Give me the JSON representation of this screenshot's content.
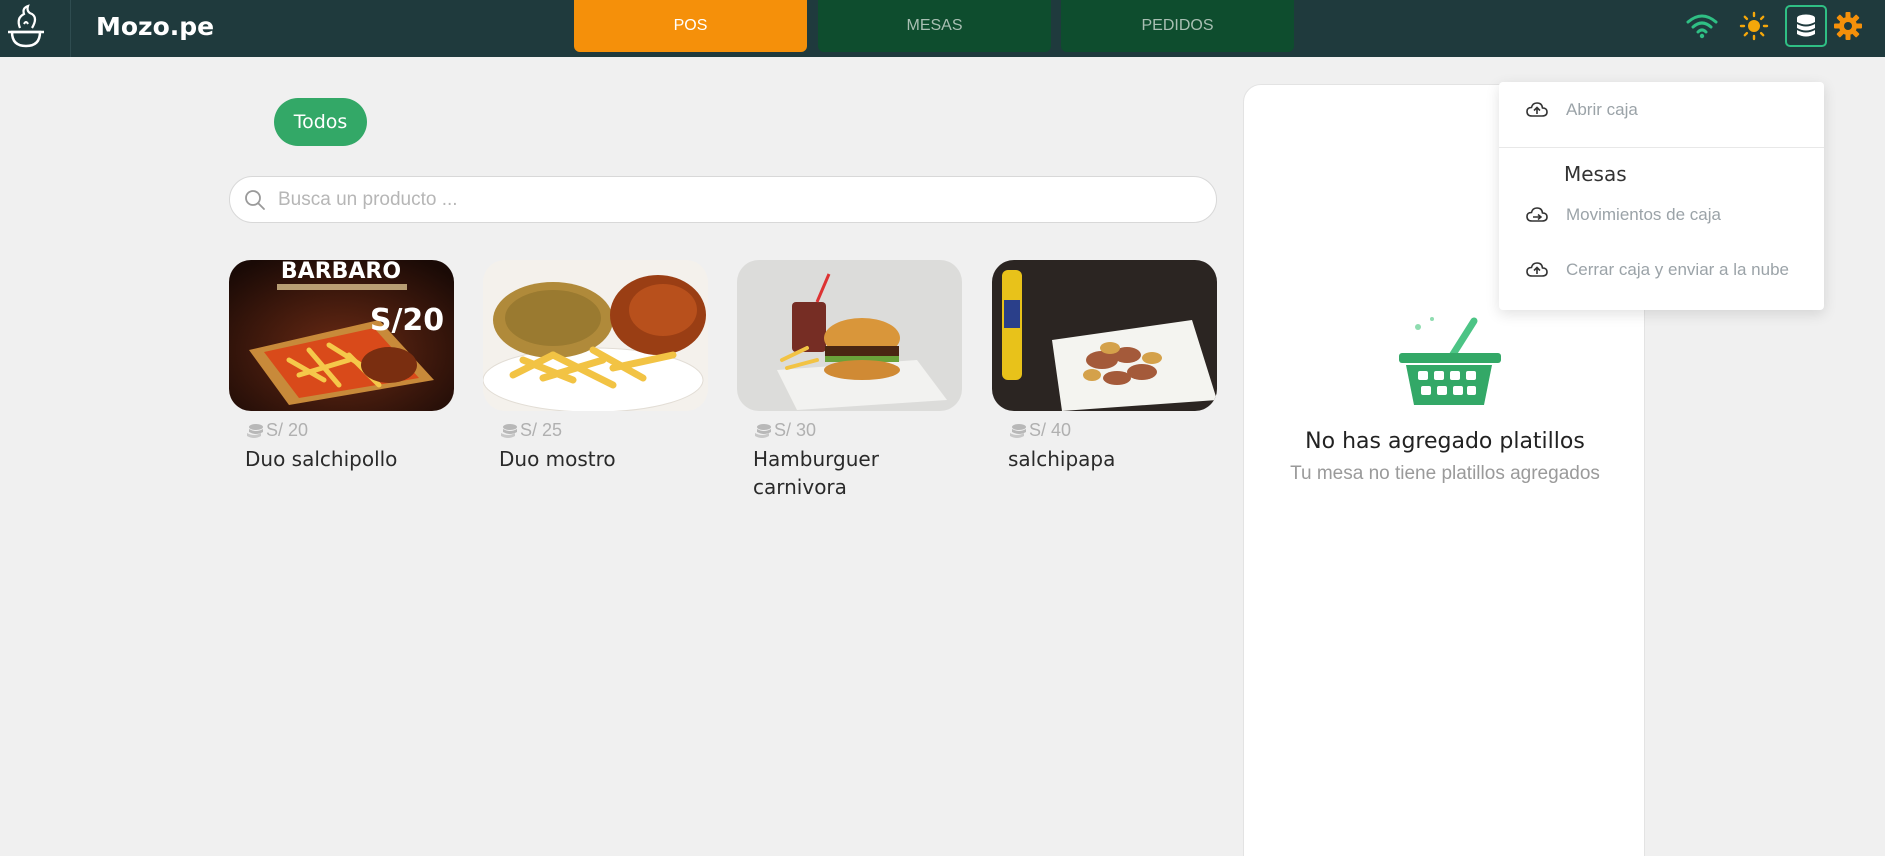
{
  "brand": {
    "name": "Mozo.pe",
    "logo_icon": "chef-hat-icon"
  },
  "tabs": [
    {
      "label": "POS",
      "active": true
    },
    {
      "label": "MESAS",
      "active": false
    },
    {
      "label": "PEDIDOS",
      "active": false
    }
  ],
  "topbar_icons": {
    "wifi": "wifi-icon",
    "theme": "sun-icon",
    "cash": "coins-icon",
    "settings": "gear-icon"
  },
  "filters": {
    "active_label": "Todos"
  },
  "search": {
    "placeholder": "Busca un producto ...",
    "value": ""
  },
  "products": [
    {
      "price": "S/ 20",
      "name": "Duo salchipollo",
      "image_text": "BARBARO",
      "image_badge": "S/20"
    },
    {
      "price": "S/ 25",
      "name": "Duo mostro"
    },
    {
      "price": "S/ 30",
      "name": "Hamburguer carnivora"
    },
    {
      "price": "S/ 40",
      "name": "salchipapa"
    }
  ],
  "cart": {
    "empty_title": "No has agregado platillos",
    "empty_subtitle": "Tu mesa no tiene platillos agregados"
  },
  "dropdown": {
    "open_label": "Abrir caja",
    "section_header": "Mesas",
    "movements_label": "Movimientos de caja",
    "close_label": "Cerrar caja y enviar a la nube"
  },
  "colors": {
    "topbar": "#1f3a3d",
    "accent_orange": "#f5900a",
    "tab_dark_green": "#0e4d2e",
    "brand_green": "#33a867",
    "highlight_teal": "#2fbf84"
  }
}
